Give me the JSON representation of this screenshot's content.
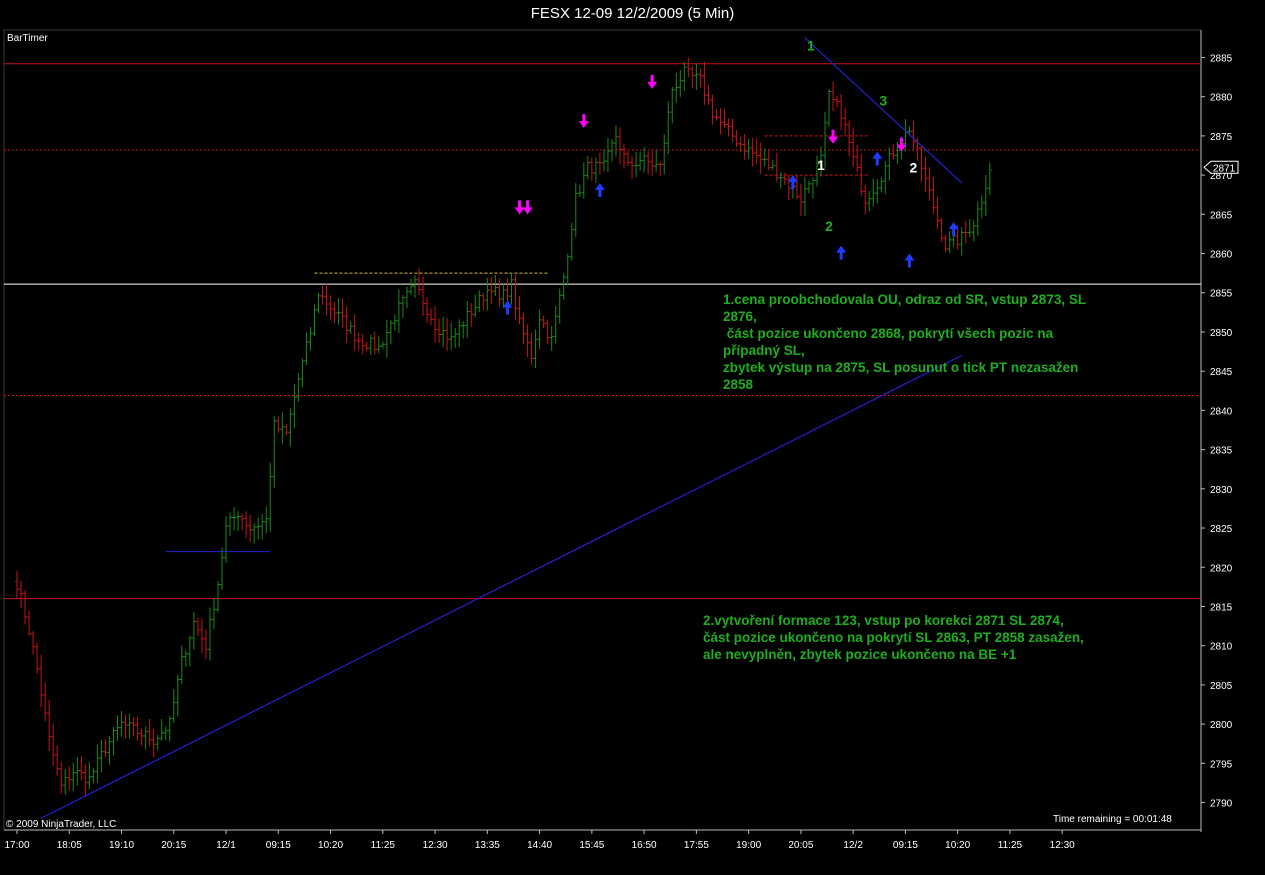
{
  "window": {
    "title": "FESX 12-09  12/2/2009 (5 Min)"
  },
  "indicator_label": "BarTimer",
  "copyright": "© 2009 NinjaTrader, LLC",
  "time_remaining": "Time remaining = 00:01:48",
  "annotations": {
    "note1_lines": [
      "1.cena proobchodovala OU, odraz od SR, vstup 2873, SL",
      "2876,",
      " část pozice ukončeno 2868, pokrytí všech pozic na",
      "případný SL,",
      "zbytek výstup na 2875, SL posunut o tick PT nezasažen",
      "2858"
    ],
    "note2_lines": [
      "2.vytvoření formace 123, vstup po korekci 2871 SL 2874,",
      "část pozice ukončeno na pokrytí SL 2863, PT 2858 zasažen,",
      "ale nevyplněn, zbytek pozice ukončeno na BE +1"
    ]
  },
  "colors": {
    "background": "#000000",
    "up_bar": "#1a8a1a",
    "down_bar": "#c81414",
    "red_line": "#c81414",
    "white_line": "#ffffff",
    "trend_line": "#2222d0",
    "long_arrow": "#1e3cff",
    "short_arrow": "#ff00ff",
    "annotation_text": "#1fae1f",
    "wave_label": "#1fae1f"
  },
  "chart_data": {
    "type": "candlestick",
    "instrument": "FESX 12-09",
    "timeframe": "5 Min",
    "y_axis": {
      "ylim": [
        2786.5,
        2888.5
      ],
      "ticks": [
        2790,
        2795,
        2800,
        2805,
        2810,
        2815,
        2820,
        2825,
        2830,
        2835,
        2840,
        2845,
        2850,
        2855,
        2860,
        2865,
        2870,
        2875,
        2880,
        2885
      ],
      "current_price": "2871"
    },
    "x_axis": {
      "tick_labels": [
        "17:00",
        "18:05",
        "19:10",
        "20:15",
        "12/1",
        "09:15",
        "10:20",
        "11:25",
        "12:30",
        "13:35",
        "14:40",
        "15:45",
        "16:50",
        "17:55",
        "19:00",
        "20:05",
        "12/2",
        "09:15",
        "10:20",
        "11:25",
        "12:30"
      ],
      "bars_per_tick": 13
    },
    "keyframes": [
      [
        0,
        2818
      ],
      [
        3,
        2812
      ],
      [
        5,
        2807
      ],
      [
        8,
        2798
      ],
      [
        11,
        2792
      ],
      [
        14,
        2794
      ],
      [
        18,
        2793
      ],
      [
        22,
        2797
      ],
      [
        26,
        2800
      ],
      [
        30,
        2799
      ],
      [
        34,
        2798
      ],
      [
        38,
        2800
      ],
      [
        41,
        2808
      ],
      [
        44,
        2813
      ],
      [
        47,
        2810
      ],
      [
        50,
        2818
      ],
      [
        52,
        2825
      ],
      [
        55,
        2827
      ],
      [
        58,
        2825
      ],
      [
        62,
        2826
      ],
      [
        64,
        2838
      ],
      [
        67,
        2837
      ],
      [
        70,
        2844
      ],
      [
        73,
        2850
      ],
      [
        75,
        2855
      ],
      [
        80,
        2852
      ],
      [
        85,
        2849
      ],
      [
        90,
        2848
      ],
      [
        95,
        2853
      ],
      [
        99,
        2856
      ],
      [
        104,
        2851
      ],
      [
        108,
        2849
      ],
      [
        112,
        2852
      ],
      [
        118,
        2856
      ],
      [
        120,
        2854
      ],
      [
        123,
        2856
      ],
      [
        125,
        2851
      ],
      [
        128,
        2847
      ],
      [
        130,
        2852
      ],
      [
        133,
        2849
      ],
      [
        136,
        2857
      ],
      [
        139,
        2867
      ],
      [
        142,
        2871
      ],
      [
        146,
        2871
      ],
      [
        149,
        2875
      ],
      [
        152,
        2871
      ],
      [
        155,
        2872
      ],
      [
        160,
        2871
      ],
      [
        163,
        2881
      ],
      [
        166,
        2883
      ],
      [
        170,
        2882
      ],
      [
        173,
        2878
      ],
      [
        176,
        2876
      ],
      [
        180,
        2874
      ],
      [
        185,
        2872
      ],
      [
        190,
        2870
      ],
      [
        195,
        2867
      ],
      [
        200,
        2872
      ],
      [
        202,
        2880
      ],
      [
        205,
        2878
      ],
      [
        208,
        2872
      ],
      [
        211,
        2867
      ],
      [
        214,
        2869
      ],
      [
        218,
        2873
      ],
      [
        222,
        2876
      ],
      [
        225,
        2871
      ],
      [
        228,
        2866
      ],
      [
        231,
        2861
      ],
      [
        235,
        2862
      ],
      [
        238,
        2864
      ],
      [
        240,
        2867
      ],
      [
        242,
        2871
      ]
    ],
    "horizontal_lines": [
      {
        "price": 2884.2,
        "style": "solid",
        "color": "red"
      },
      {
        "price": 2873.2,
        "style": "dotted",
        "color": "red"
      },
      {
        "price": 2856.1,
        "style": "solid",
        "color": "white"
      },
      {
        "price": 2841.9,
        "style": "dotted",
        "color": "red"
      },
      {
        "price": 2816.0,
        "style": "solid",
        "color": "red"
      }
    ],
    "segments": [
      {
        "x1": 37,
        "y1": 2822.0,
        "x2": 63,
        "y2": 2822.0,
        "style": "solid",
        "color": "blue"
      },
      {
        "x1": 74,
        "y1": 2857.5,
        "x2": 132,
        "y2": 2857.5,
        "style": "dashed",
        "color": "yellow"
      },
      {
        "x1": 186,
        "y1": 2875.0,
        "x2": 212,
        "y2": 2875.0,
        "style": "dashed",
        "color": "red"
      },
      {
        "x1": 186,
        "y1": 2870.0,
        "x2": 212,
        "y2": 2870.0,
        "style": "dashed",
        "color": "red"
      }
    ],
    "trend_lines": [
      {
        "x1": 6,
        "y1": 2788.0,
        "x2": 235,
        "y2": 2847.0,
        "color": "blue"
      },
      {
        "x1": 196,
        "y1": 2887.5,
        "x2": 235,
        "y2": 2869.0,
        "color": "blue"
      }
    ],
    "wave_labels": [
      {
        "text": "1",
        "x": 197.5,
        "price": 2886.5,
        "color": "green"
      },
      {
        "text": "2",
        "x": 202,
        "price": 2863.5,
        "color": "green"
      },
      {
        "text": "3",
        "x": 215.5,
        "price": 2879.5,
        "color": "green"
      },
      {
        "text": "1",
        "x": 200,
        "price": 2871.3,
        "color": "white"
      },
      {
        "text": "2",
        "x": 223,
        "price": 2871.0,
        "color": "white"
      }
    ],
    "signals": [
      {
        "x": 141,
        "price": 2876,
        "kind": "short"
      },
      {
        "x": 125,
        "price": 2865,
        "kind": "short"
      },
      {
        "x": 127,
        "price": 2865,
        "kind": "short"
      },
      {
        "x": 158,
        "price": 2881,
        "kind": "short"
      },
      {
        "x": 203,
        "price": 2874,
        "kind": "short"
      },
      {
        "x": 220,
        "price": 2873,
        "kind": "short"
      },
      {
        "x": 145,
        "price": 2869,
        "kind": "long"
      },
      {
        "x": 122,
        "price": 2854,
        "kind": "long"
      },
      {
        "x": 193,
        "price": 2870,
        "kind": "long"
      },
      {
        "x": 205,
        "price": 2861,
        "kind": "long"
      },
      {
        "x": 214,
        "price": 2873,
        "kind": "long"
      },
      {
        "x": 222,
        "price": 2860,
        "kind": "long"
      },
      {
        "x": 233,
        "price": 2864,
        "kind": "long"
      }
    ]
  }
}
